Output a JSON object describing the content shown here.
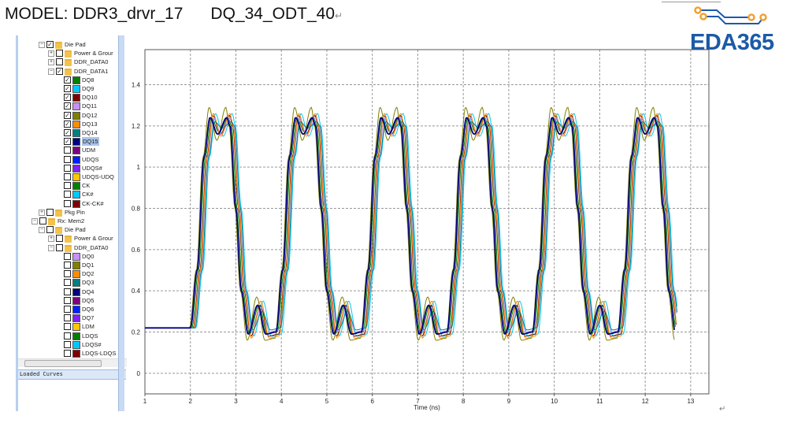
{
  "header": {
    "title": "MODEL: DDR3_drvr_17      DQ_34_ODT_40",
    "return_mark": "↵"
  },
  "logo": {
    "text": "EDA365",
    "text_color": "#1b5aa8",
    "dot_color": "#f0a030"
  },
  "panel": {
    "loaded_curves_label": "Loaded Curves",
    "tree": [
      {
        "level": 1,
        "type": "folder",
        "label": "Die Pad",
        "checked": true,
        "expand": "-"
      },
      {
        "level": 2,
        "type": "folder",
        "label": "Power & Grour",
        "checked": false,
        "expand": "+"
      },
      {
        "level": 2,
        "type": "folder",
        "label": "DDR_DATA0",
        "checked": false,
        "expand": "+"
      },
      {
        "level": 2,
        "type": "folder",
        "label": "DDR_DATA1",
        "checked": true,
        "expand": "-"
      },
      {
        "level": 3,
        "type": "signal",
        "label": "DQ8",
        "checked": true,
        "color": "#008000"
      },
      {
        "level": 3,
        "type": "signal",
        "label": "DQ9",
        "checked": true,
        "color": "#00c8ff"
      },
      {
        "level": 3,
        "type": "signal",
        "label": "DQ10",
        "checked": true,
        "color": "#800000"
      },
      {
        "level": 3,
        "type": "signal",
        "label": "DQ11",
        "checked": true,
        "color": "#c890ff"
      },
      {
        "level": 3,
        "type": "signal",
        "label": "DQ12",
        "checked": true,
        "color": "#808000"
      },
      {
        "level": 3,
        "type": "signal",
        "label": "DQ13",
        "checked": true,
        "color": "#ff8c00"
      },
      {
        "level": 3,
        "type": "signal",
        "label": "DQ14",
        "checked": true,
        "color": "#008080"
      },
      {
        "level": 3,
        "type": "signal",
        "label": "DQ15",
        "checked": true,
        "color": "#000080",
        "selected": true
      },
      {
        "level": 3,
        "type": "signal",
        "label": "UDM",
        "checked": false,
        "color": "#800080"
      },
      {
        "level": 3,
        "type": "signal",
        "label": "UDQS",
        "checked": false,
        "color": "#0020ff"
      },
      {
        "level": 3,
        "type": "signal",
        "label": "UDQS#",
        "checked": false,
        "color": "#8020ff"
      },
      {
        "level": 3,
        "type": "signal",
        "label": "UDQS-UDQ",
        "checked": false,
        "color": "#ffc800"
      },
      {
        "level": 3,
        "type": "signal",
        "label": "CK",
        "checked": false,
        "color": "#008000"
      },
      {
        "level": 3,
        "type": "signal",
        "label": "CK#",
        "checked": false,
        "color": "#00c8ff"
      },
      {
        "level": 3,
        "type": "signal",
        "label": "CK-CK#",
        "checked": false,
        "color": "#800000"
      },
      {
        "level": 1,
        "type": "folder",
        "label": "Pkg Pin",
        "checked": false,
        "expand": "+"
      },
      {
        "level": 0,
        "type": "folder",
        "label": "Rx: Mem2",
        "checked": false,
        "expand": "-"
      },
      {
        "level": 1,
        "type": "folder",
        "label": "Die Pad",
        "checked": false,
        "expand": "-"
      },
      {
        "level": 2,
        "type": "folder",
        "label": "Power & Grour",
        "checked": false,
        "expand": "+"
      },
      {
        "level": 2,
        "type": "folder",
        "label": "DDR_DATA0",
        "checked": false,
        "expand": "-"
      },
      {
        "level": 3,
        "type": "signal",
        "label": "DQ0",
        "checked": false,
        "color": "#c890ff"
      },
      {
        "level": 3,
        "type": "signal",
        "label": "DQ1",
        "checked": false,
        "color": "#808000"
      },
      {
        "level": 3,
        "type": "signal",
        "label": "DQ2",
        "checked": false,
        "color": "#ff8c00"
      },
      {
        "level": 3,
        "type": "signal",
        "label": "DQ3",
        "checked": false,
        "color": "#008080"
      },
      {
        "level": 3,
        "type": "signal",
        "label": "DQ4",
        "checked": false,
        "color": "#000080"
      },
      {
        "level": 3,
        "type": "signal",
        "label": "DQ5",
        "checked": false,
        "color": "#800080"
      },
      {
        "level": 3,
        "type": "signal",
        "label": "DQ6",
        "checked": false,
        "color": "#0020ff"
      },
      {
        "level": 3,
        "type": "signal",
        "label": "DQ7",
        "checked": false,
        "color": "#8020ff"
      },
      {
        "level": 3,
        "type": "signal",
        "label": "LDM",
        "checked": false,
        "color": "#ffc800"
      },
      {
        "level": 3,
        "type": "signal",
        "label": "LDQS",
        "checked": false,
        "color": "#008000"
      },
      {
        "level": 3,
        "type": "signal",
        "label": "LDQS#",
        "checked": false,
        "color": "#00c8ff"
      },
      {
        "level": 3,
        "type": "signal",
        "label": "LDQS-LDQS",
        "checked": false,
        "color": "#800000"
      }
    ]
  },
  "chart_data": {
    "type": "line",
    "title": "",
    "xlabel": "Time (ns)",
    "ylabel": "",
    "xlim": [
      1,
      13.4
    ],
    "ylim": [
      -0.1,
      1.57
    ],
    "xticks": [
      1,
      2,
      3,
      4,
      5,
      6,
      7,
      8,
      9,
      10,
      11,
      12,
      13
    ],
    "yticks": [
      0,
      0.2,
      0.4,
      0.6,
      0.8,
      1,
      1.2,
      1.4
    ],
    "ytick_labels": [
      "0",
      "0.2",
      "0.4",
      "0.6",
      "0.8",
      "1",
      "1.2",
      "1.4"
    ],
    "grid": true,
    "legend": "none",
    "waveform": {
      "initial_low_v": 0.22,
      "first_edge_ns": 2.0,
      "period_ns": 1.88,
      "cycles": 6,
      "end_ns": 12.65,
      "template_t_ns": [
        0,
        0.15,
        0.3,
        0.43,
        0.6,
        0.8,
        0.87,
        1.0,
        1.12,
        1.27,
        1.48,
        1.66,
        1.88
      ],
      "template_role": [
        "low",
        "rise",
        "rise",
        "peak",
        "dip",
        "peak",
        "hi",
        "fall",
        "fall",
        "trough",
        "bump",
        "trough",
        "low"
      ]
    },
    "series": [
      {
        "name": "DQ8",
        "color": "#008000",
        "skew_ns": 0.03,
        "peak": 1.24,
        "dip": 1.17,
        "trough": 0.19,
        "bump": 0.33
      },
      {
        "name": "DQ9",
        "color": "#00c8ff",
        "skew_ns": 0.12,
        "peak": 1.26,
        "dip": 1.15,
        "trough": 0.18,
        "bump": 0.35
      },
      {
        "name": "DQ10",
        "color": "#800000",
        "skew_ns": 0.06,
        "peak": 1.25,
        "dip": 1.16,
        "trough": 0.18,
        "bump": 0.33
      },
      {
        "name": "DQ11",
        "color": "#c890ff",
        "skew_ns": 0.08,
        "peak": 1.24,
        "dip": 1.16,
        "trough": 0.2,
        "bump": 0.32
      },
      {
        "name": "DQ12",
        "color": "#808000",
        "skew_ns": -0.02,
        "peak": 1.29,
        "dip": 1.13,
        "trough": 0.16,
        "bump": 0.37
      },
      {
        "name": "DQ13",
        "color": "#ff8c00",
        "skew_ns": 0.07,
        "peak": 1.26,
        "dip": 1.15,
        "trough": 0.17,
        "bump": 0.35
      },
      {
        "name": "DQ14",
        "color": "#008080",
        "skew_ns": 0.1,
        "peak": 1.22,
        "dip": 1.19,
        "trough": 0.21,
        "bump": 0.3
      },
      {
        "name": "DQ15",
        "color": "#000080",
        "skew_ns": 0.0,
        "peak": 1.24,
        "dip": 1.16,
        "trough": 0.19,
        "bump": 0.33
      }
    ]
  }
}
